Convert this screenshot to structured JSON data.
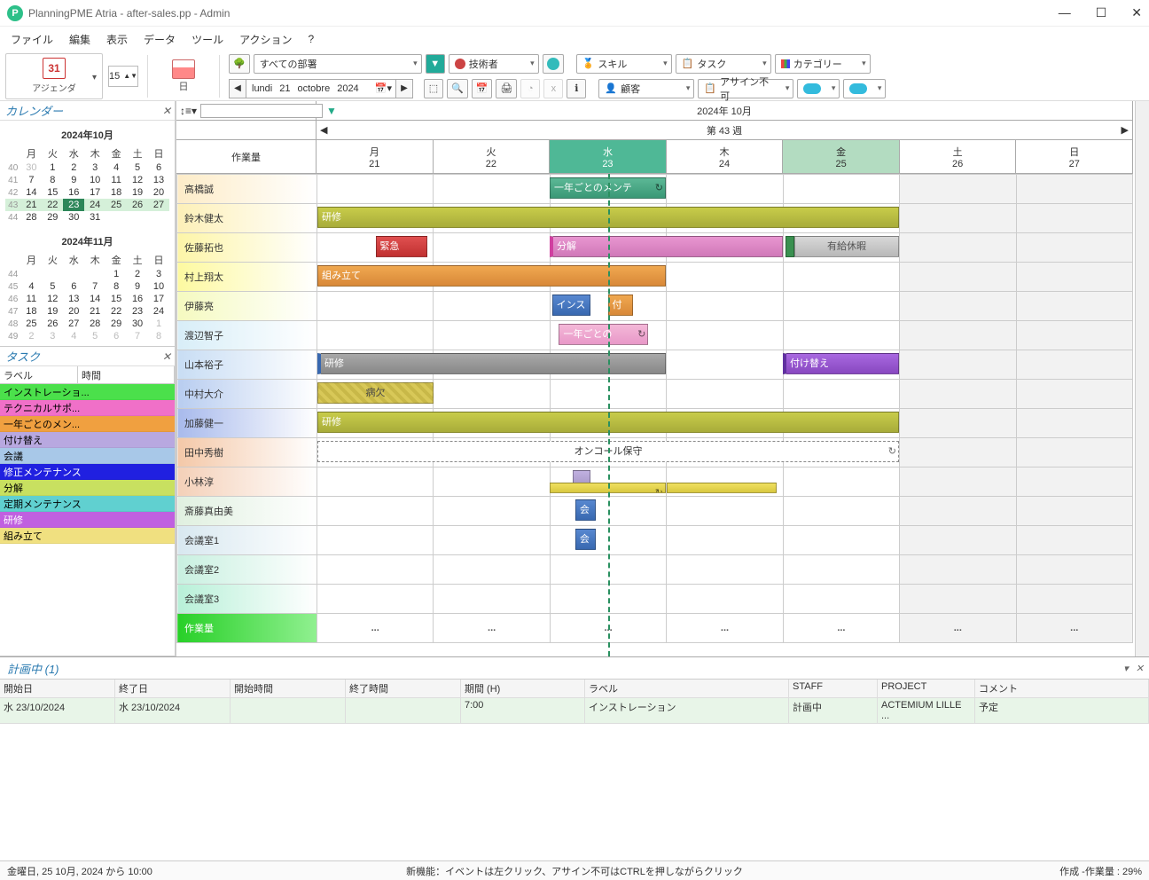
{
  "window": {
    "title": "PlanningPME Atria - after-sales.pp - Admin"
  },
  "menu": [
    "ファイル",
    "編集",
    "表示",
    "データ",
    "ツール",
    "アクション",
    "?"
  ],
  "toolbar": {
    "agenda_number": "31",
    "agenda_label": "アジェンダ",
    "spin_value": "15",
    "day_label": "日",
    "dept": "すべての部署",
    "tech": "技術者",
    "skill": "スキル",
    "task": "タスク",
    "category": "カテゴリー",
    "date": {
      "weekday": "lundi",
      "day": "21",
      "month": "octobre",
      "year": "2024"
    },
    "client": "顧客",
    "unassign": "アサイン不可"
  },
  "side": {
    "calendar_title": "カレンダー",
    "month1": {
      "title": "2024年10月",
      "dow": [
        "月",
        "火",
        "水",
        "木",
        "金",
        "土",
        "日"
      ],
      "weeks": [
        {
          "wk": "40",
          "d": [
            "30",
            "1",
            "2",
            "3",
            "4",
            "5",
            "6"
          ],
          "dim0": true
        },
        {
          "wk": "41",
          "d": [
            "7",
            "8",
            "9",
            "10",
            "11",
            "12",
            "13"
          ]
        },
        {
          "wk": "42",
          "d": [
            "14",
            "15",
            "16",
            "17",
            "18",
            "19",
            "20"
          ]
        },
        {
          "wk": "43",
          "d": [
            "21",
            "22",
            "23",
            "24",
            "25",
            "26",
            "27"
          ],
          "hl": true,
          "today": 2
        },
        {
          "wk": "44",
          "d": [
            "28",
            "29",
            "30",
            "31",
            "",
            "",
            ""
          ]
        }
      ]
    },
    "month2": {
      "title": "2024年11月",
      "dow": [
        "月",
        "火",
        "水",
        "木",
        "金",
        "土",
        "日"
      ],
      "weeks": [
        {
          "wk": "44",
          "d": [
            "",
            "",
            "",
            "",
            "1",
            "2",
            "3"
          ]
        },
        {
          "wk": "45",
          "d": [
            "4",
            "5",
            "6",
            "7",
            "8",
            "9",
            "10"
          ]
        },
        {
          "wk": "46",
          "d": [
            "11",
            "12",
            "13",
            "14",
            "15",
            "16",
            "17"
          ]
        },
        {
          "wk": "47",
          "d": [
            "18",
            "19",
            "20",
            "21",
            "22",
            "23",
            "24"
          ]
        },
        {
          "wk": "48",
          "d": [
            "25",
            "26",
            "27",
            "28",
            "29",
            "30",
            "1"
          ],
          "dimlast": true
        },
        {
          "wk": "49",
          "d": [
            "2",
            "3",
            "4",
            "5",
            "6",
            "7",
            "8"
          ],
          "dim": true
        }
      ]
    },
    "tasks_title": "タスク",
    "task_cols": {
      "label": "ラベル",
      "time": "時間"
    },
    "tasks": [
      {
        "label": "インストレーショ...",
        "bg": "#4be04b"
      },
      {
        "label": "テクニカルサポ...",
        "bg": "#f070c8"
      },
      {
        "label": "一年ごとのメン...",
        "bg": "#f0a040"
      },
      {
        "label": "付け替え",
        "bg": "#b8a8e0"
      },
      {
        "label": "会議",
        "bg": "#a8c8e8"
      },
      {
        "label": "修正メンテナンス",
        "bg": "#2020e0",
        "fg": "#fff"
      },
      {
        "label": "分解",
        "bg": "#c8e060"
      },
      {
        "label": "定期メンテナンス",
        "bg": "#60d0d0"
      },
      {
        "label": "研修",
        "bg": "#c060e0",
        "fg": "#fff"
      },
      {
        "label": "組み立て",
        "bg": "#f0e080"
      }
    ]
  },
  "gantt": {
    "month_title": "2024年 10月",
    "week_title": "第 43 週",
    "res_header": "作業量",
    "days": [
      {
        "dow": "月",
        "num": "21"
      },
      {
        "dow": "火",
        "num": "22"
      },
      {
        "dow": "水",
        "num": "23",
        "cls": "wed"
      },
      {
        "dow": "木",
        "num": "24"
      },
      {
        "dow": "金",
        "num": "25",
        "cls": "fri"
      },
      {
        "dow": "土",
        "num": "26",
        "wkend": true
      },
      {
        "dow": "日",
        "num": "27",
        "wkend": true
      }
    ],
    "resources": [
      "高橋誠",
      "鈴木健太",
      "佐藤拓也",
      "村上翔太",
      "伊藤亮",
      "渡辺智子",
      "山本裕子",
      "中村大介",
      "加藤健一",
      "田中秀樹",
      "小林淳",
      "斎藤真由美",
      "会議室1",
      "会議室2",
      "会議室3"
    ],
    "workload_label": "作業量",
    "load_dots": "...",
    "bars": [
      {
        "row": 0,
        "startDay": 2,
        "startPct": 0,
        "endDay": 2,
        "endPct": 100,
        "text": "一年ごとのメンテ",
        "cls": "bar-green",
        "refresh": true
      },
      {
        "row": 1,
        "startDay": 0,
        "startPct": 0,
        "endDay": 4,
        "endPct": 100,
        "text": "研修",
        "cls": "bar-olive"
      },
      {
        "row": 2,
        "startDay": 0,
        "startPct": 50,
        "endDay": 0,
        "endPct": 95,
        "text": "緊急",
        "cls": "bar-red"
      },
      {
        "row": 2,
        "startDay": 2,
        "startPct": 0,
        "endDay": 3,
        "endPct": 100,
        "text": "分解",
        "cls": "bar-pink"
      },
      {
        "row": 2,
        "startDay": 4,
        "startPct": 2,
        "endDay": 4,
        "endPct": 10,
        "text": "",
        "cls": "bar-greenbar"
      },
      {
        "row": 2,
        "startDay": 4,
        "startPct": 10,
        "endDay": 4,
        "endPct": 100,
        "text": "有給休暇",
        "cls": "bar-gray"
      },
      {
        "row": 3,
        "startDay": 0,
        "startPct": 0,
        "endDay": 2,
        "endPct": 100,
        "text": "組み立て",
        "cls": "bar-orange"
      },
      {
        "row": 4,
        "startDay": 2,
        "startPct": 2,
        "endDay": 2,
        "endPct": 35,
        "text": "インス",
        "cls": "bar-blue"
      },
      {
        "row": 4,
        "startDay": 2,
        "startPct": 50,
        "endDay": 2,
        "endPct": 72,
        "text": "付",
        "cls": "bar-orange"
      },
      {
        "row": 5,
        "startDay": 2,
        "startPct": 8,
        "endDay": 2,
        "endPct": 85,
        "text": "一年ごとの",
        "cls": "bar-pink2",
        "refresh": true
      },
      {
        "row": 6,
        "startDay": 0,
        "startPct": 0,
        "endDay": 2,
        "endPct": 100,
        "text": "研修",
        "cls": "bar-gray2"
      },
      {
        "row": 6,
        "startDay": 4,
        "startPct": 0,
        "endDay": 4,
        "endPct": 100,
        "text": "付け替え",
        "cls": "bar-purple"
      },
      {
        "row": 7,
        "startDay": 0,
        "startPct": 0,
        "endDay": 0,
        "endPct": 100,
        "text": "病欠",
        "cls": "bar-hatch"
      },
      {
        "row": 8,
        "startDay": 0,
        "startPct": 0,
        "endDay": 4,
        "endPct": 100,
        "text": "研修",
        "cls": "bar-olive"
      },
      {
        "row": 9,
        "startDay": 0,
        "startPct": 0,
        "endDay": 4,
        "endPct": 100,
        "text": "オンコール保守",
        "cls": "bar-outline",
        "refresh": true
      },
      {
        "row": 10,
        "startDay": 2,
        "startPct": 20,
        "endDay": 2,
        "endPct": 35,
        "text": "",
        "cls": "bar-lilac"
      },
      {
        "row": 10,
        "startDay": 2,
        "startPct": 0,
        "endDay": 2,
        "endPct": 100,
        "text": "",
        "cls": "bar-yellow",
        "top2": true,
        "refresh": true
      },
      {
        "row": 10,
        "startDay": 3,
        "startPct": 0,
        "endDay": 3,
        "endPct": 95,
        "text": "",
        "cls": "bar-yellow",
        "top2": true
      },
      {
        "row": 11,
        "startDay": 2,
        "startPct": 22,
        "endDay": 2,
        "endPct": 40,
        "text": "会",
        "cls": "bar-blue"
      },
      {
        "row": 12,
        "startDay": 2,
        "startPct": 22,
        "endDay": 2,
        "endPct": 40,
        "text": "会",
        "cls": "bar-blue"
      }
    ]
  },
  "planning": {
    "title": "計画中 (1)",
    "cols": [
      "開始日",
      "終了日",
      "開始時間",
      "終了時間",
      "期間 (H)",
      "ラベル",
      "STAFF",
      "PROJECT",
      "コメント"
    ],
    "row": {
      "start": "水 23/10/2024",
      "end": "水 23/10/2024",
      "st": "",
      "et": "",
      "dur": "7:00",
      "label": "インストレーション",
      "staff": "計画中",
      "proj": "ACTEMIUM LILLE ...",
      "com": "予定"
    }
  },
  "status": {
    "left": "金曜日, 25 10月, 2024 から 10:00",
    "center": "新機能：イベントは左クリック、アサイン不可はCTRLを押しながらクリック",
    "right": "作成 -作業量 : 29%"
  }
}
